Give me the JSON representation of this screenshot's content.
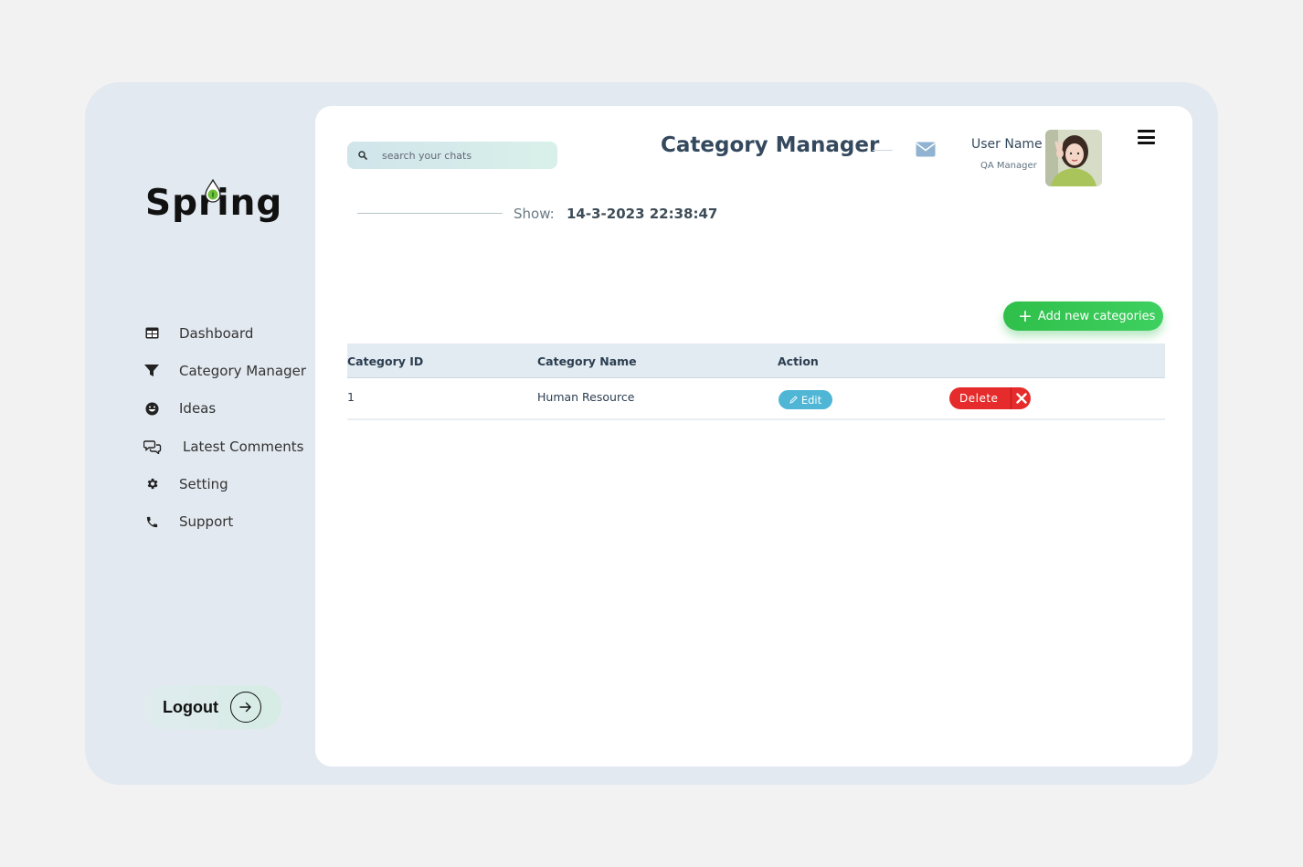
{
  "sidebar": {
    "logo": "Spring",
    "items": [
      {
        "label": "Dashboard",
        "icon": "dashboard-icon"
      },
      {
        "label": "Category Manager",
        "icon": "filter-icon"
      },
      {
        "label": "Ideas",
        "icon": "smile-icon"
      },
      {
        "label": "Latest Comments",
        "icon": "comments-icon"
      },
      {
        "label": "Setting",
        "icon": "gear-icon"
      },
      {
        "label": "Support",
        "icon": "phone-icon"
      }
    ],
    "logout_label": "Logout"
  },
  "header": {
    "search_placeholder": "search your chats",
    "title": "Category Manager",
    "user_name": "User Name",
    "user_role": "QA Manager"
  },
  "show": {
    "label": "Show:",
    "datetime": "14-3-2023 22:38:47"
  },
  "actions": {
    "add_label": "Add new categories"
  },
  "table": {
    "columns": [
      "Category ID",
      "Category Name",
      "Action"
    ],
    "rows": [
      {
        "id": "1",
        "name": "Human Resource",
        "edit_label": "Edit",
        "delete_label": "Delete"
      }
    ]
  },
  "colors": {
    "accent_green": "#2fbf4a",
    "delete_red": "#e52b2b",
    "edit_blue": "#4fb6d6",
    "frame_bg": "#e3e9f0"
  }
}
